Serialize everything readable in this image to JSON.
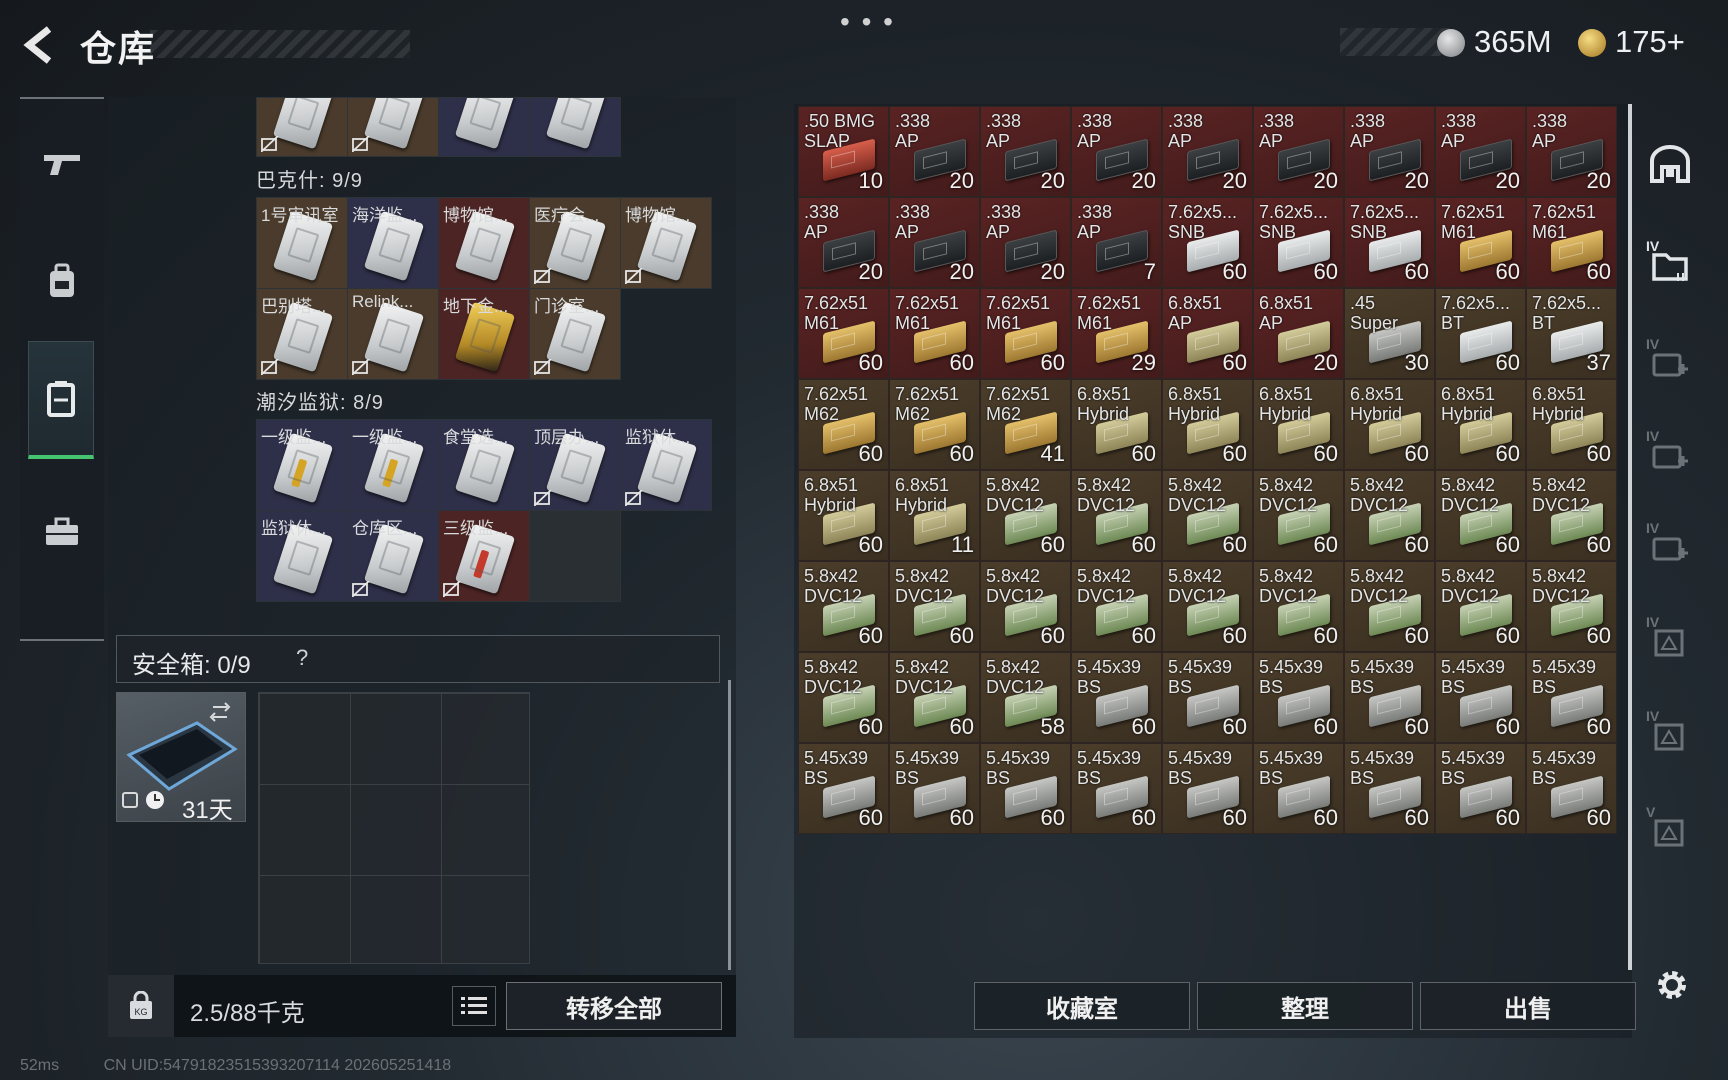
{
  "header": {
    "title": "仓库",
    "more": "• • •",
    "currency": [
      {
        "name": "silver-coin",
        "value": "365M"
      },
      {
        "name": "gold-coin",
        "value": "175+"
      }
    ]
  },
  "left_rail": {
    "items": [
      {
        "icon": "gun-icon"
      },
      {
        "icon": "backpack-icon"
      },
      {
        "icon": "storage-icon",
        "active": true
      },
      {
        "icon": "briefcase-icon"
      }
    ]
  },
  "keycards": {
    "partial_row": [
      {
        "label": "",
        "bg": "brown"
      },
      {
        "label": "",
        "bg": "brown"
      },
      {
        "label": "",
        "bg": "navy"
      },
      {
        "label": "",
        "bg": "navy"
      }
    ],
    "sections": [
      {
        "title": "巴克什: 9/9",
        "items": [
          {
            "label": "1号审讯室",
            "bg": "brown"
          },
          {
            "label": "海洋监...",
            "bg": "navy"
          },
          {
            "label": "博物馆...",
            "bg": "red"
          },
          {
            "label": "医疗会...",
            "bg": "brown"
          },
          {
            "label": "博物馆...",
            "bg": "brown"
          },
          {
            "label": "巴别塔...",
            "bg": "brown"
          },
          {
            "label": "Relink...",
            "bg": "brown"
          },
          {
            "label": "地下金...",
            "bg": "red"
          },
          {
            "label": "门诊室...",
            "bg": "brown"
          }
        ]
      },
      {
        "title": "潮汐监狱: 8/9",
        "items": [
          {
            "label": "一级监...",
            "bg": "navy"
          },
          {
            "label": "一级监...",
            "bg": "navy"
          },
          {
            "label": "食堂选...",
            "bg": "navy"
          },
          {
            "label": "顶层办...",
            "bg": "navy"
          },
          {
            "label": "监狱休...",
            "bg": "navy"
          },
          {
            "label": "监狱休...",
            "bg": "navy"
          },
          {
            "label": "仓库区...",
            "bg": "navy"
          },
          {
            "label": "三级监...",
            "bg": "red"
          }
        ]
      }
    ]
  },
  "safebox": {
    "label": "安全箱: 0/9",
    "help": "?",
    "remaining": "31天"
  },
  "footer": {
    "weight": "2.5/88千克",
    "transfer_all": "转移全部"
  },
  "status": {
    "ping": "52ms",
    "uid": "CN UID:547918235153932071​14 202605251418"
  },
  "storage": {
    "items": [
      {
        "n1": ".50 BMG",
        "n2": "SLAP",
        "count": "10",
        "bg": "red",
        "box": "redcard"
      },
      {
        "n1": ".338",
        "n2": "AP",
        "count": "20",
        "bg": "red",
        "box": "black"
      },
      {
        "n1": ".338",
        "n2": "AP",
        "count": "20",
        "bg": "red",
        "box": "black"
      },
      {
        "n1": ".338",
        "n2": "AP",
        "count": "20",
        "bg": "red",
        "box": "black"
      },
      {
        "n1": ".338",
        "n2": "AP",
        "count": "20",
        "bg": "red",
        "box": "black"
      },
      {
        "n1": ".338",
        "n2": "AP",
        "count": "20",
        "bg": "red",
        "box": "black"
      },
      {
        "n1": ".338",
        "n2": "AP",
        "count": "20",
        "bg": "red",
        "box": "black"
      },
      {
        "n1": ".338",
        "n2": "AP",
        "count": "20",
        "bg": "red",
        "box": "black"
      },
      {
        "n1": ".338",
        "n2": "AP",
        "count": "20",
        "bg": "red",
        "box": "black"
      },
      {
        "n1": ".338",
        "n2": "AP",
        "count": "20",
        "bg": "red",
        "box": "black"
      },
      {
        "n1": ".338",
        "n2": "AP",
        "count": "20",
        "bg": "red",
        "box": "black"
      },
      {
        "n1": ".338",
        "n2": "AP",
        "count": "20",
        "bg": "red",
        "box": "black"
      },
      {
        "n1": ".338",
        "n2": "AP",
        "count": "7",
        "bg": "red",
        "box": "black"
      },
      {
        "n1": "7.62x5...",
        "n2": "SNB",
        "count": "60",
        "bg": "red",
        "box": "white"
      },
      {
        "n1": "7.62x5...",
        "n2": "SNB",
        "count": "60",
        "bg": "red",
        "box": "white"
      },
      {
        "n1": "7.62x5...",
        "n2": "SNB",
        "count": "60",
        "bg": "red",
        "box": "white"
      },
      {
        "n1": "7.62x51",
        "n2": "M61",
        "count": "60",
        "bg": "red",
        "box": "gold"
      },
      {
        "n1": "7.62x51",
        "n2": "M61",
        "count": "60",
        "bg": "red",
        "box": "gold"
      },
      {
        "n1": "7.62x51",
        "n2": "M61",
        "count": "60",
        "bg": "red",
        "box": "gold"
      },
      {
        "n1": "7.62x51",
        "n2": "M61",
        "count": "60",
        "bg": "red",
        "box": "gold"
      },
      {
        "n1": "7.62x51",
        "n2": "M61",
        "count": "60",
        "bg": "red",
        "box": "gold"
      },
      {
        "n1": "7.62x51",
        "n2": "M61",
        "count": "29",
        "bg": "red",
        "box": "gold"
      },
      {
        "n1": "6.8x51",
        "n2": "AP",
        "count": "60",
        "bg": "red",
        "box": "olive"
      },
      {
        "n1": "6.8x51",
        "n2": "AP",
        "count": "20",
        "bg": "red",
        "box": "olive"
      },
      {
        "n1": ".45",
        "n2": "Super",
        "count": "30",
        "bg": "brown",
        "box": "gray"
      },
      {
        "n1": "7.62x5...",
        "n2": "BT",
        "count": "60",
        "bg": "brown",
        "box": "white"
      },
      {
        "n1": "7.62x5...",
        "n2": "BT",
        "count": "37",
        "bg": "brown",
        "box": "white"
      },
      {
        "n1": "7.62x51",
        "n2": "M62",
        "count": "60",
        "bg": "brown",
        "box": "gold"
      },
      {
        "n1": "7.62x51",
        "n2": "M62",
        "count": "60",
        "bg": "brown",
        "box": "gold"
      },
      {
        "n1": "7.62x51",
        "n2": "M62",
        "count": "41",
        "bg": "brown",
        "box": "gold"
      },
      {
        "n1": "6.8x51",
        "n2": "Hybrid",
        "count": "60",
        "bg": "brown",
        "box": "olive"
      },
      {
        "n1": "6.8x51",
        "n2": "Hybrid",
        "count": "60",
        "bg": "brown",
        "box": "olive"
      },
      {
        "n1": "6.8x51",
        "n2": "Hybrid",
        "count": "60",
        "bg": "brown",
        "box": "olive"
      },
      {
        "n1": "6.8x51",
        "n2": "Hybrid",
        "count": "60",
        "bg": "brown",
        "box": "olive"
      },
      {
        "n1": "6.8x51",
        "n2": "Hybrid",
        "count": "60",
        "bg": "brown",
        "box": "olive"
      },
      {
        "n1": "6.8x51",
        "n2": "Hybrid",
        "count": "60",
        "bg": "brown",
        "box": "olive"
      },
      {
        "n1": "6.8x51",
        "n2": "Hybrid",
        "count": "60",
        "bg": "brown",
        "box": "olive"
      },
      {
        "n1": "6.8x51",
        "n2": "Hybrid",
        "count": "11",
        "bg": "brown",
        "box": "olive"
      },
      {
        "n1": "5.8x42",
        "n2": "DVC12",
        "count": "60",
        "bg": "brown",
        "box": "green"
      },
      {
        "n1": "5.8x42",
        "n2": "DVC12",
        "count": "60",
        "bg": "brown",
        "box": "green"
      },
      {
        "n1": "5.8x42",
        "n2": "DVC12",
        "count": "60",
        "bg": "brown",
        "box": "green"
      },
      {
        "n1": "5.8x42",
        "n2": "DVC12",
        "count": "60",
        "bg": "brown",
        "box": "green"
      },
      {
        "n1": "5.8x42",
        "n2": "DVC12",
        "count": "60",
        "bg": "brown",
        "box": "green"
      },
      {
        "n1": "5.8x42",
        "n2": "DVC12",
        "count": "60",
        "bg": "brown",
        "box": "green"
      },
      {
        "n1": "5.8x42",
        "n2": "DVC12",
        "count": "60",
        "bg": "brown",
        "box": "green"
      },
      {
        "n1": "5.8x42",
        "n2": "DVC12",
        "count": "60",
        "bg": "brown",
        "box": "green"
      },
      {
        "n1": "5.8x42",
        "n2": "DVC12",
        "count": "60",
        "bg": "brown",
        "box": "green"
      },
      {
        "n1": "5.8x42",
        "n2": "DVC12",
        "count": "60",
        "bg": "brown",
        "box": "green"
      },
      {
        "n1": "5.8x42",
        "n2": "DVC12",
        "count": "60",
        "bg": "brown",
        "box": "green"
      },
      {
        "n1": "5.8x42",
        "n2": "DVC12",
        "count": "60",
        "bg": "brown",
        "box": "green"
      },
      {
        "n1": "5.8x42",
        "n2": "DVC12",
        "count": "60",
        "bg": "brown",
        "box": "green"
      },
      {
        "n1": "5.8x42",
        "n2": "DVC12",
        "count": "60",
        "bg": "brown",
        "box": "green"
      },
      {
        "n1": "5.8x42",
        "n2": "DVC12",
        "count": "60",
        "bg": "brown",
        "box": "green"
      },
      {
        "n1": "5.8x42",
        "n2": "DVC12",
        "count": "60",
        "bg": "brown",
        "box": "green"
      },
      {
        "n1": "5.8x42",
        "n2": "DVC12",
        "count": "60",
        "bg": "brown",
        "box": "green"
      },
      {
        "n1": "5.8x42",
        "n2": "DVC12",
        "count": "60",
        "bg": "brown",
        "box": "green"
      },
      {
        "n1": "5.8x42",
        "n2": "DVC12",
        "count": "58",
        "bg": "brown",
        "box": "green"
      },
      {
        "n1": "5.45x39",
        "n2": "BS",
        "count": "60",
        "bg": "brown",
        "box": "gray"
      },
      {
        "n1": "5.45x39",
        "n2": "BS",
        "count": "60",
        "bg": "brown",
        "box": "gray"
      },
      {
        "n1": "5.45x39",
        "n2": "BS",
        "count": "60",
        "bg": "brown",
        "box": "gray"
      },
      {
        "n1": "5.45x39",
        "n2": "BS",
        "count": "60",
        "bg": "brown",
        "box": "gray"
      },
      {
        "n1": "5.45x39",
        "n2": "BS",
        "count": "60",
        "bg": "brown",
        "box": "gray"
      },
      {
        "n1": "5.45x39",
        "n2": "BS",
        "count": "60",
        "bg": "brown",
        "box": "gray"
      },
      {
        "n1": "5.45x39",
        "n2": "BS",
        "count": "60",
        "bg": "brown",
        "box": "gray"
      },
      {
        "n1": "5.45x39",
        "n2": "BS",
        "count": "60",
        "bg": "brown",
        "box": "gray"
      },
      {
        "n1": "5.45x39",
        "n2": "BS",
        "count": "60",
        "bg": "brown",
        "box": "gray"
      },
      {
        "n1": "5.45x39",
        "n2": "BS",
        "count": "60",
        "bg": "brown",
        "box": "gray"
      },
      {
        "n1": "5.45x39",
        "n2": "BS",
        "count": "60",
        "bg": "brown",
        "box": "gray"
      },
      {
        "n1": "5.45x39",
        "n2": "BS",
        "count": "60",
        "bg": "brown",
        "box": "gray"
      },
      {
        "n1": "5.45x39",
        "n2": "BS",
        "count": "60",
        "bg": "brown",
        "box": "gray"
      },
      {
        "n1": "5.45x39",
        "n2": "BS",
        "count": "60",
        "bg": "brown",
        "box": "gray"
      },
      {
        "n1": "5.45x39",
        "n2": "BS",
        "count": "60",
        "bg": "brown",
        "box": "gray"
      }
    ],
    "buttons": {
      "collection": "收藏室",
      "sort": "整理",
      "sell": "出售"
    }
  },
  "right_rail": {
    "items": [
      {
        "icon": "arch-icon",
        "tag": ""
      },
      {
        "icon": "folder-tier-icon",
        "tag": "IV"
      },
      {
        "icon": "add-tier-icon",
        "tag": "IV"
      },
      {
        "icon": "add-tier-icon",
        "tag": "IV"
      },
      {
        "icon": "add-tier-icon",
        "tag": "IV"
      },
      {
        "icon": "tier-frame-icon",
        "tag": "IV"
      },
      {
        "icon": "tier-frame-icon",
        "tag": "IV"
      },
      {
        "icon": "tier-frame-icon",
        "tag": "V"
      }
    ]
  },
  "colors": {
    "accent_green": "#47c46f",
    "cell_red": "#5a2323",
    "cell_brown": "#4b3d2a"
  }
}
